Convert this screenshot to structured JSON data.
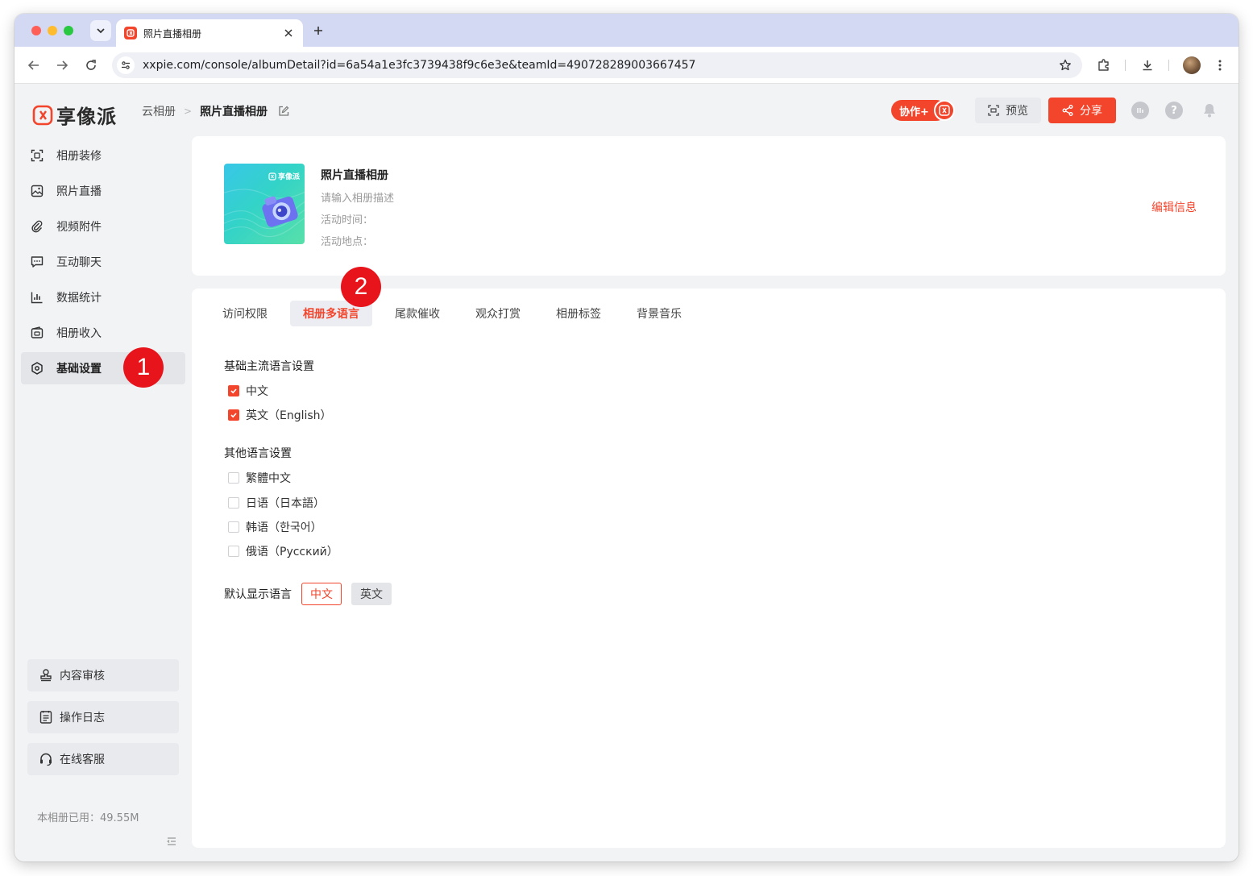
{
  "browser": {
    "tab_title": "照片直播相册",
    "url": "xxpie.com/console/albumDetail?id=6a54a1e3fc3739438f9c6e3e&teamId=490728289003667457"
  },
  "header": {
    "logo_text": "享像派",
    "breadcrumb_root": "云相册",
    "breadcrumb_current": "照片直播相册",
    "collab_label": "协作+",
    "preview_label": "预览",
    "share_label": "分享"
  },
  "sidebar": {
    "items": [
      {
        "label": "相册装修",
        "icon": "frame-icon"
      },
      {
        "label": "照片直播",
        "icon": "image-icon"
      },
      {
        "label": "视频附件",
        "icon": "paperclip-icon"
      },
      {
        "label": "互动聊天",
        "icon": "chat-icon"
      },
      {
        "label": "数据统计",
        "icon": "chart-icon"
      },
      {
        "label": "相册收入",
        "icon": "wallet-icon"
      },
      {
        "label": "基础设置",
        "icon": "gear-icon",
        "active": true
      }
    ],
    "bottom": [
      {
        "label": "内容审核",
        "icon": "stamp-icon"
      },
      {
        "label": "操作日志",
        "icon": "log-icon"
      },
      {
        "label": "在线客服",
        "icon": "headset-icon"
      }
    ],
    "storage": "本相册已用：49.55M"
  },
  "album": {
    "name": "照片直播相册",
    "description": "请输入相册描述",
    "time_label": "活动时间：",
    "place_label": "活动地点：",
    "edit_label": "编辑信息",
    "cover_watermark": "享像派"
  },
  "tabs": [
    "访问权限",
    "相册多语言",
    "尾款催收",
    "观众打赏",
    "相册标签",
    "背景音乐"
  ],
  "active_tab": 1,
  "language": {
    "main_title": "基础主流语言设置",
    "main_options": [
      {
        "label": "中文",
        "checked": true
      },
      {
        "label": "英文（English）",
        "checked": true
      }
    ],
    "other_title": "其他语言设置",
    "other_options": [
      {
        "label": "繁體中文",
        "checked": false
      },
      {
        "label": "日语（日本語）",
        "checked": false
      },
      {
        "label": "韩语（한국어）",
        "checked": false
      },
      {
        "label": "俄语（Русский）",
        "checked": false
      }
    ],
    "default_label": "默认显示语言",
    "default_options": [
      "中文",
      "英文"
    ],
    "default_selected": 0
  },
  "annotations": [
    "1",
    "2"
  ],
  "colors": {
    "accent": "#f2452c",
    "annotation": "#e8141c",
    "page_bg": "#f2f3f5"
  }
}
